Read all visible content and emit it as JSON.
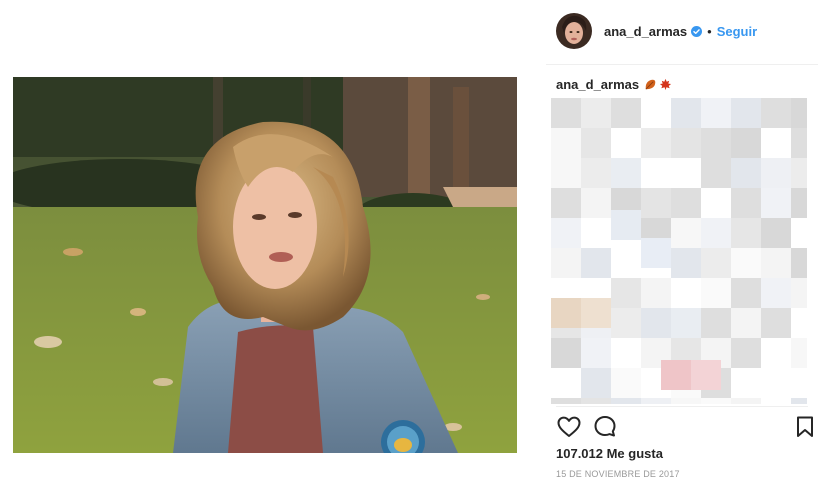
{
  "post": {
    "username": "ana_d_armas",
    "separator": "•",
    "follow_label": "Seguir",
    "caption_username": "ana_d_armas",
    "caption_emoji": [
      "fallen-leaf-emoji",
      "maple-leaf-emoji"
    ],
    "likes_text": "107.012 Me gusta",
    "date_text": "15 DE NOVIEMBRE DE 2017"
  },
  "colors": {
    "accent": "#3897f0",
    "verified": "#3897f0",
    "text": "#262626",
    "muted": "#999999",
    "divider": "#efefef"
  },
  "icons": {
    "like": "heart-outline-icon",
    "comment": "speech-bubble-icon",
    "save": "bookmark-icon",
    "verified": "verified-badge-icon"
  }
}
